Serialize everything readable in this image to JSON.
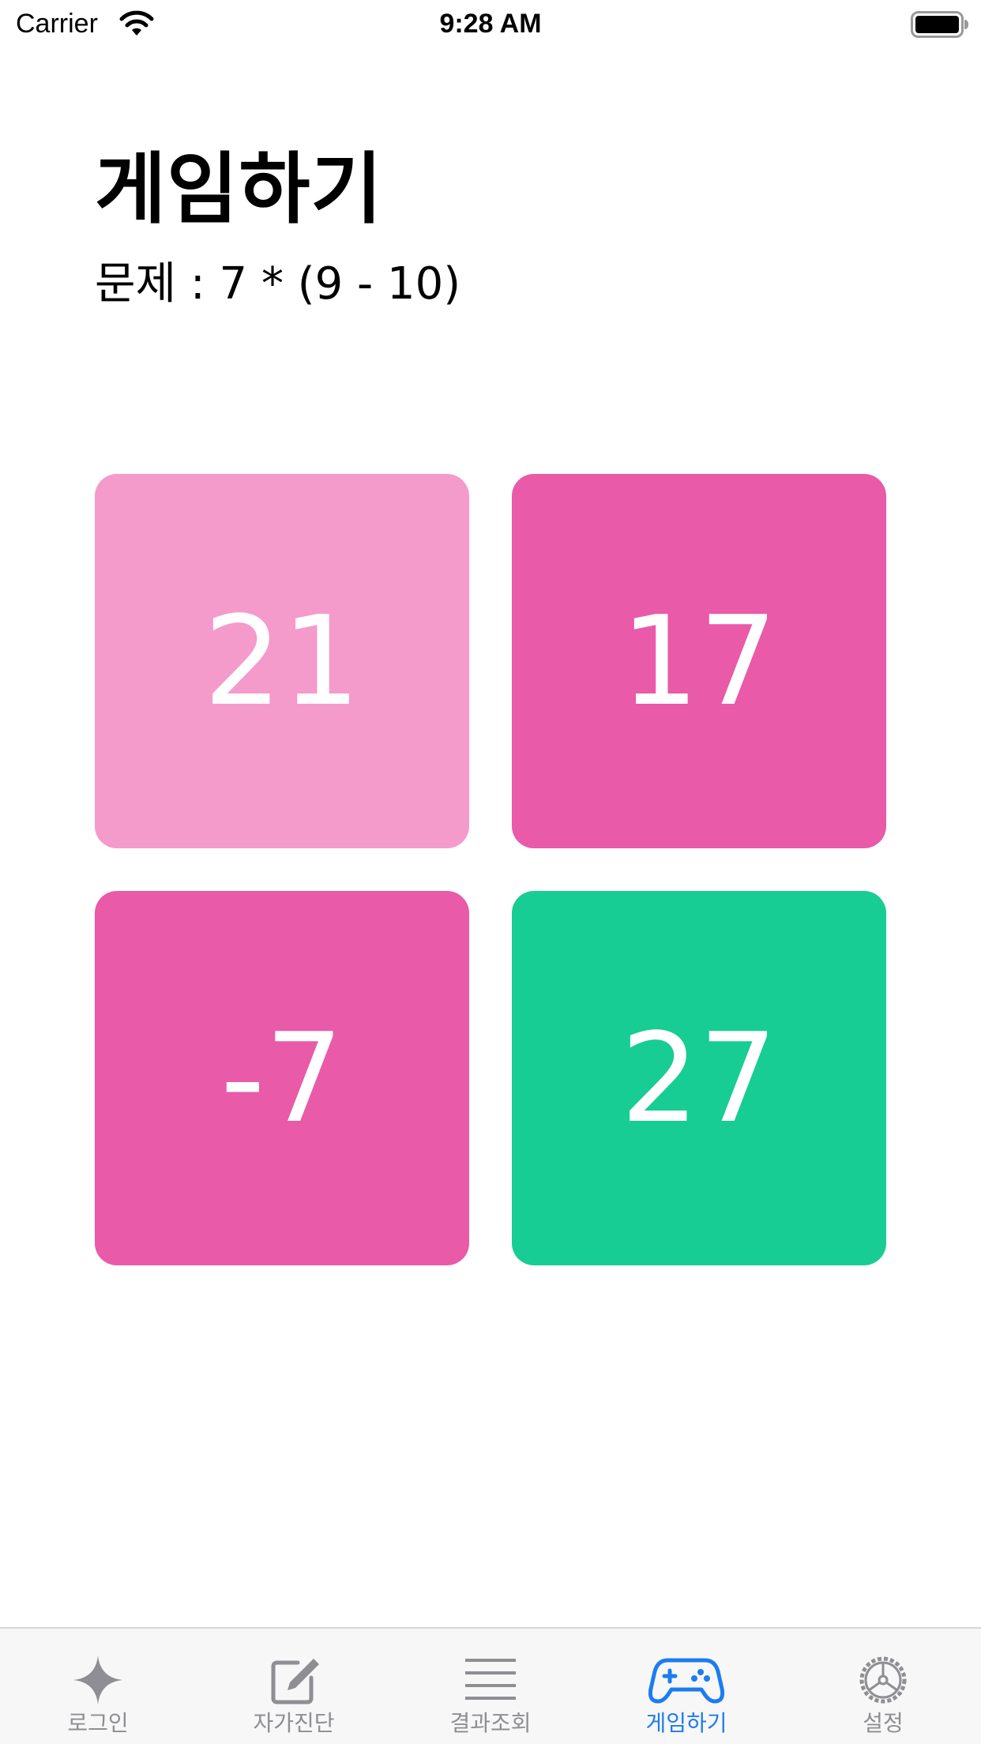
{
  "status_bar": {
    "carrier": "Carrier",
    "time": "9:28 AM",
    "icons": [
      "wifi-icon",
      "battery-icon"
    ]
  },
  "header": {
    "title": "게임하기",
    "problem": "문제 : 7 * (9 - 10)"
  },
  "answers": [
    {
      "label": "21",
      "color": "#f49bcb"
    },
    {
      "label": "17",
      "color": "#e95aa8"
    },
    {
      "label": "-7",
      "color": "#e95aa8"
    },
    {
      "label": "27",
      "color": "#17cd93"
    }
  ],
  "tab_bar": {
    "active_color": "#1c7cf0",
    "inactive_color": "#8e8e93",
    "tabs": [
      {
        "label": "로그인",
        "icon": "sparkle-icon",
        "active": false
      },
      {
        "label": "자가진단",
        "icon": "edit-icon",
        "active": false
      },
      {
        "label": "결과조회",
        "icon": "list-icon",
        "active": false
      },
      {
        "label": "게임하기",
        "icon": "gamecontroller-icon",
        "active": true
      },
      {
        "label": "설정",
        "icon": "gear-icon",
        "active": false
      }
    ]
  }
}
